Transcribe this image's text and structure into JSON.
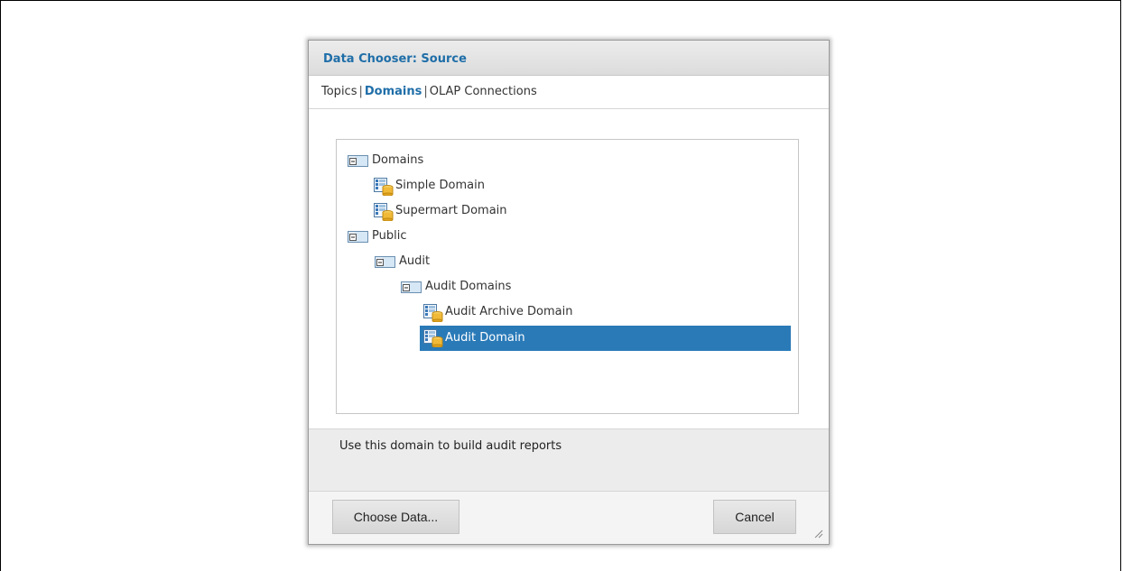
{
  "dialog": {
    "title": "Data Chooser: Source",
    "tabs": [
      {
        "label": "Topics",
        "active": false
      },
      {
        "label": "Domains",
        "active": true
      },
      {
        "label": "OLAP Connections",
        "active": false
      }
    ],
    "tab_separator": "|",
    "tree": [
      {
        "label": "Domains",
        "type": "folder",
        "expanded": true,
        "depth": 0
      },
      {
        "label": "Simple Domain",
        "type": "domain",
        "depth": 1
      },
      {
        "label": "Supermart Domain",
        "type": "domain",
        "depth": 1
      },
      {
        "label": "Public",
        "type": "folder",
        "expanded": true,
        "depth": 0
      },
      {
        "label": "Audit",
        "type": "folder",
        "expanded": true,
        "depth": 1
      },
      {
        "label": "Audit Domains",
        "type": "folder",
        "expanded": true,
        "depth": 2
      },
      {
        "label": "Audit Archive Domain",
        "type": "domain",
        "depth": 3
      },
      {
        "label": "Audit Domain",
        "type": "domain",
        "depth": 3,
        "selected": true
      }
    ],
    "description": "Use this domain to build audit reports",
    "buttons": {
      "choose_data": "Choose Data...",
      "cancel": "Cancel"
    }
  },
  "colors": {
    "accent": "#1f6ea8",
    "selection": "#2a7ab8"
  },
  "icons": {
    "folder": "folder-expanded-icon",
    "domain": "domain-icon",
    "resize": "resize-grip-icon"
  }
}
